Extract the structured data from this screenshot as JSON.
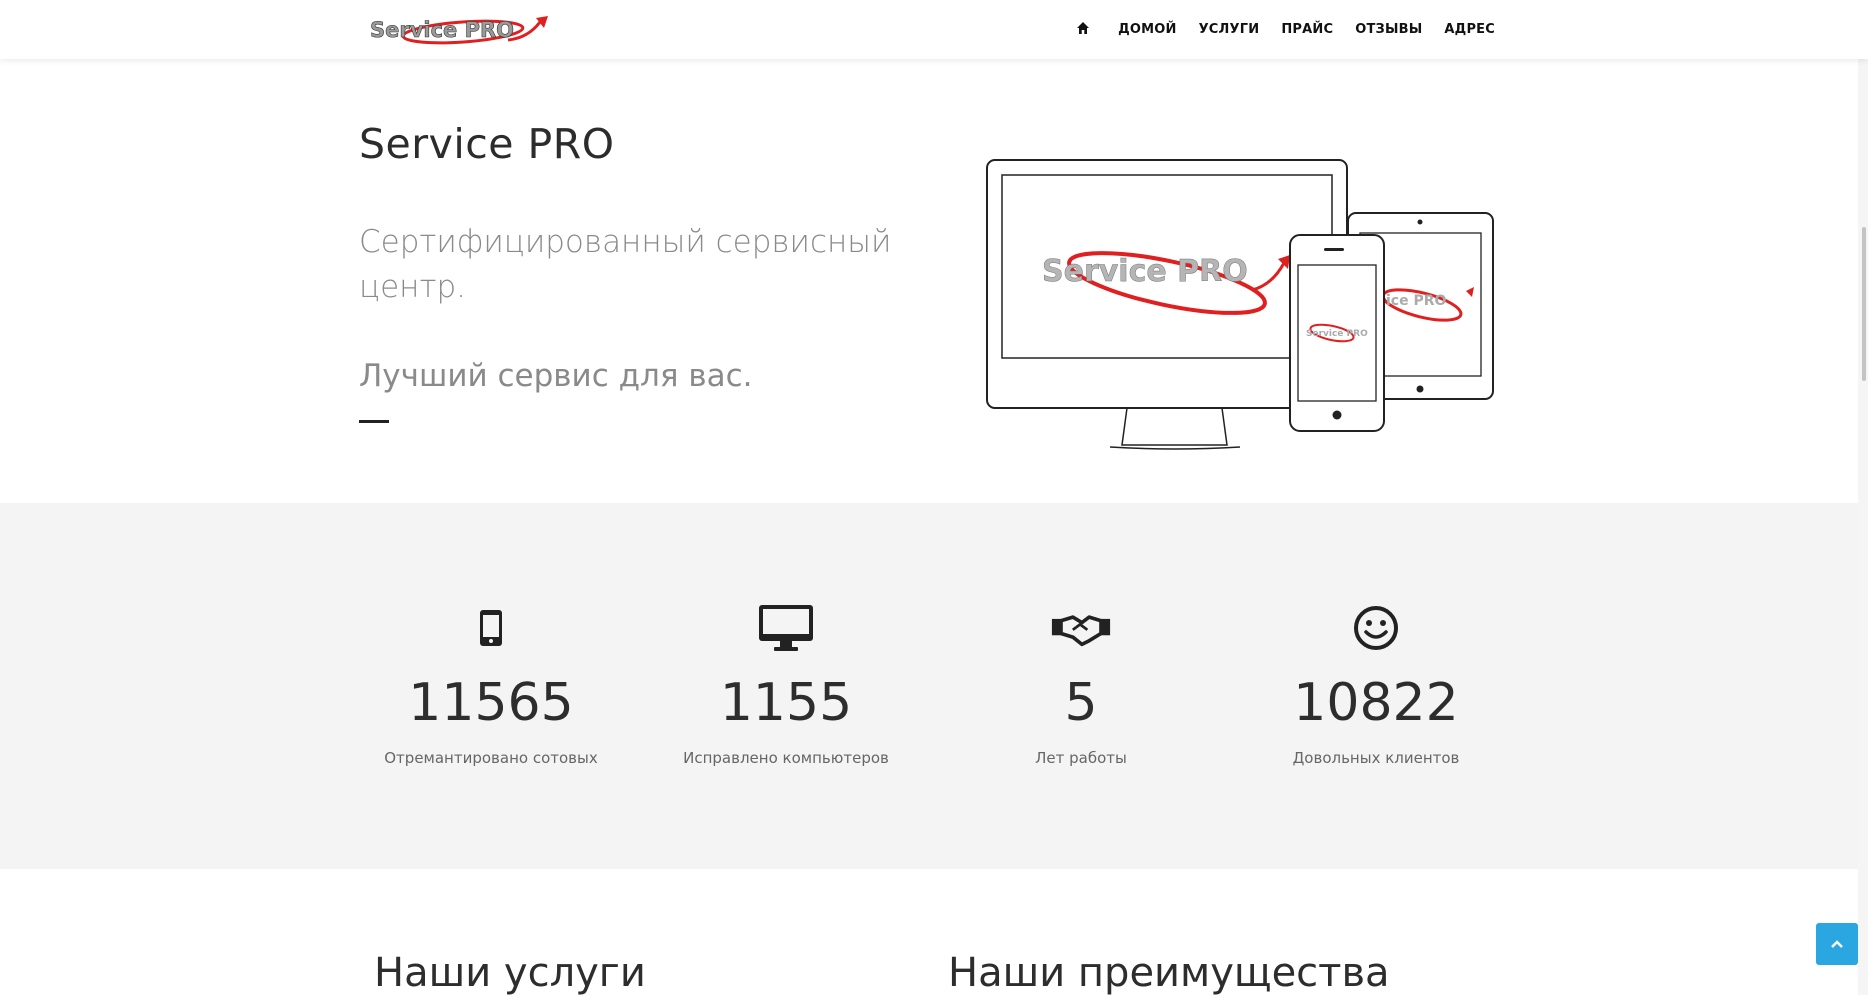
{
  "brand": {
    "logo_text": "Service PRO",
    "accent_color": "#e02020"
  },
  "nav": {
    "home_icon": "home-icon",
    "items": [
      {
        "label": "ДОМОЙ"
      },
      {
        "label": "УСЛУГИ"
      },
      {
        "label": "ПРАЙС"
      },
      {
        "label": "ОТЗЫВЫ"
      },
      {
        "label": "АДРЕС"
      }
    ]
  },
  "hero": {
    "title": "Service PRO",
    "subtitle": "Сертифицированный сервисный центр.",
    "tagline": "Лучший сервис для вас.",
    "illustration_logo_text": "Service PRO"
  },
  "stats": [
    {
      "icon": "mobile-phone-icon",
      "value": "11565",
      "label": "Отремантировано сотовых"
    },
    {
      "icon": "desktop-monitor-icon",
      "value": "1155",
      "label": "Исправлено компьютеров"
    },
    {
      "icon": "handshake-icon",
      "value": "5",
      "label": "Лет работы"
    },
    {
      "icon": "smiley-face-icon",
      "value": "10822",
      "label": "Довольных клиентов"
    }
  ],
  "sections": {
    "services_title": "Наши услуги",
    "advantages_title": "Наши преимущества"
  },
  "back_to_top": {
    "icon": "chevron-up-icon",
    "color": "#2aa6e0"
  }
}
